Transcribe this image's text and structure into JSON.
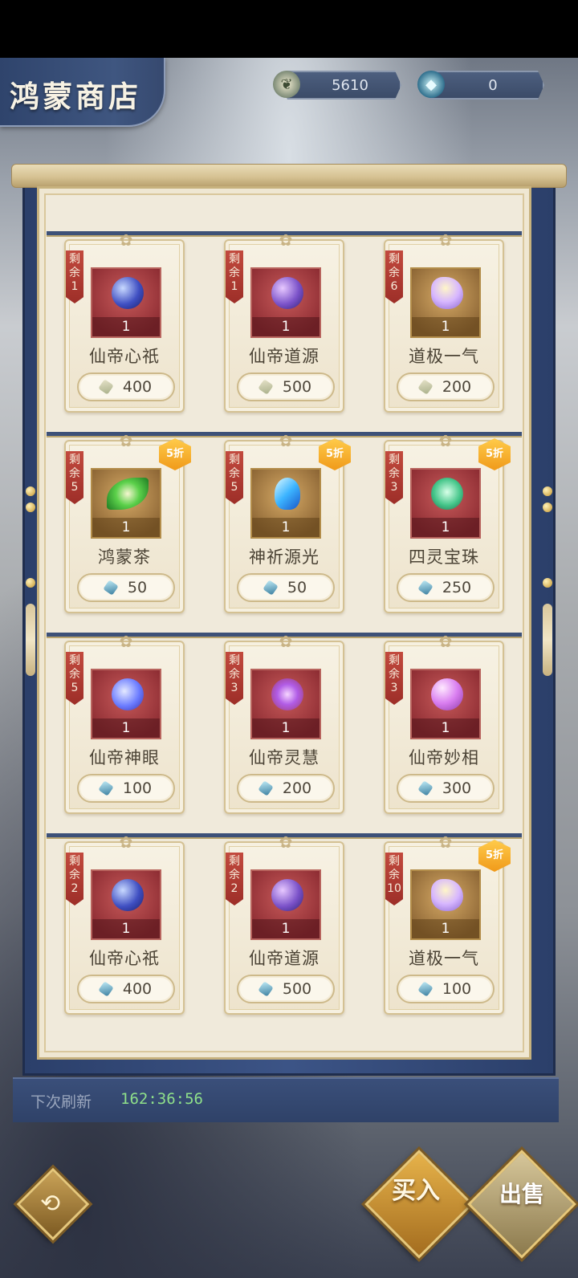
{
  "header": {
    "title": "鸿蒙商店",
    "currencies": [
      {
        "icon": "leaf-currency-icon",
        "value": "5610"
      },
      {
        "icon": "jade-currency-icon",
        "value": "0"
      }
    ]
  },
  "stock_label": [
    "剩",
    "余"
  ],
  "items": [
    {
      "stock": "1",
      "qty": "1",
      "name": "仙帝心祇",
      "price": "400",
      "currency": "leaf",
      "gem": "gem-blue",
      "discount": ""
    },
    {
      "stock": "1",
      "qty": "1",
      "name": "仙帝道源",
      "price": "500",
      "currency": "leaf",
      "gem": "gem-purple",
      "discount": ""
    },
    {
      "stock": "6",
      "qty": "1",
      "name": "道极一气",
      "price": "200",
      "currency": "leaf",
      "gem": "gem-crystal",
      "discount": ""
    },
    {
      "stock": "5",
      "qty": "1",
      "name": "鸿蒙茶",
      "price": "50",
      "currency": "jade",
      "gem": "gem-leaf",
      "discount": "5折"
    },
    {
      "stock": "5",
      "qty": "1",
      "name": "神祈源光",
      "price": "50",
      "currency": "jade",
      "gem": "gem-ice",
      "discount": "5折"
    },
    {
      "stock": "3",
      "qty": "1",
      "name": "四灵宝珠",
      "price": "250",
      "currency": "jade",
      "gem": "gem-jade",
      "discount": "5折"
    },
    {
      "stock": "5",
      "qty": "1",
      "name": "仙帝神眼",
      "price": "100",
      "currency": "jade",
      "gem": "gem-moon",
      "discount": ""
    },
    {
      "stock": "3",
      "qty": "1",
      "name": "仙帝灵慧",
      "price": "200",
      "currency": "jade",
      "gem": "gem-flower",
      "discount": ""
    },
    {
      "stock": "3",
      "qty": "1",
      "name": "仙帝妙相",
      "price": "300",
      "currency": "jade",
      "gem": "gem-pearl",
      "discount": ""
    },
    {
      "stock": "2",
      "qty": "1",
      "name": "仙帝心祇",
      "price": "400",
      "currency": "jade",
      "gem": "gem-blue",
      "discount": ""
    },
    {
      "stock": "2",
      "qty": "1",
      "name": "仙帝道源",
      "price": "500",
      "currency": "jade",
      "gem": "gem-purple",
      "discount": ""
    },
    {
      "stock": "10",
      "qty": "1",
      "name": "道极一气",
      "price": "100",
      "currency": "jade",
      "gem": "gem-crystal",
      "discount": "5折"
    }
  ],
  "refresh": {
    "label": "下次刷新",
    "time": "162:36:56"
  },
  "buttons": {
    "buy": "买入",
    "sell": "出售"
  },
  "colors": {
    "accent_blue": "#3c5486",
    "paper": "#f0eadb",
    "timer_green": "#8fe08a",
    "discount_orange": "#f09a1a"
  }
}
